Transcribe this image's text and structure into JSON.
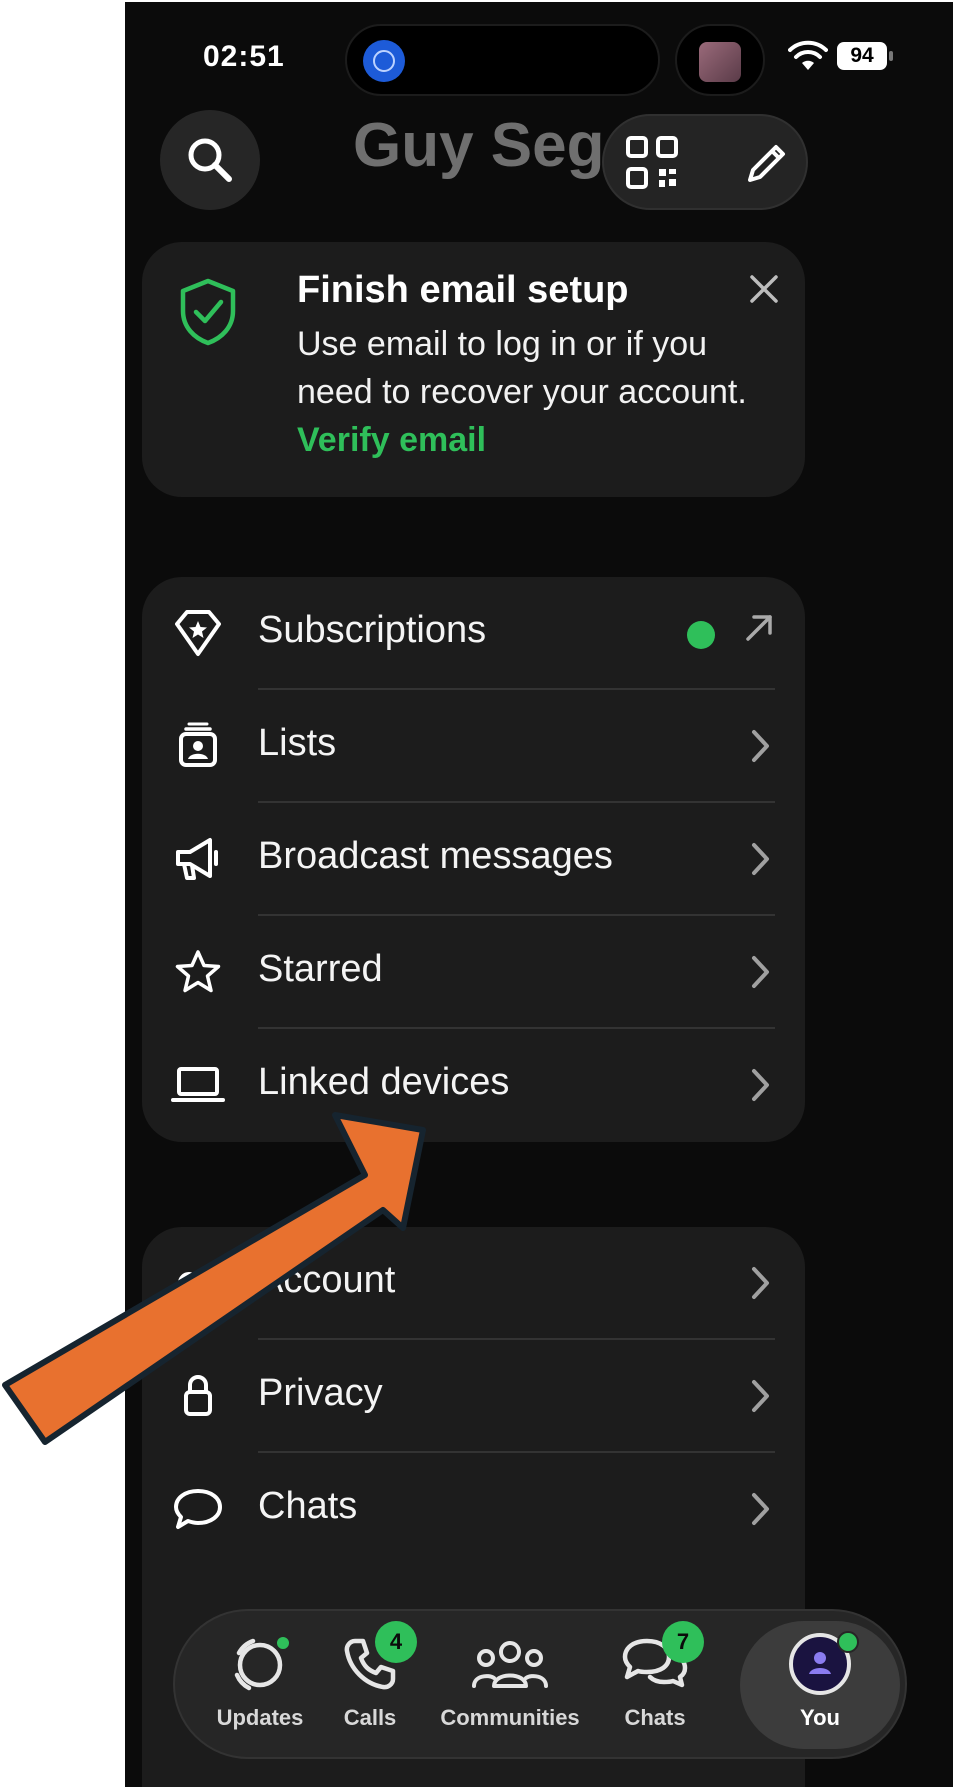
{
  "status_bar": {
    "time": "02:51",
    "battery": "94"
  },
  "header": {
    "title": "Guy Segev"
  },
  "email_card": {
    "title": "Finish email setup",
    "body": "Use email to log in or if you need to recover your account.",
    "link": "Verify email"
  },
  "menu_group_1": [
    {
      "label": "Subscriptions",
      "icon": "diamond-star-icon"
    },
    {
      "label": "Lists",
      "icon": "lists-icon"
    },
    {
      "label": "Broadcast messages",
      "icon": "megaphone-icon"
    },
    {
      "label": "Starred",
      "icon": "star-icon"
    },
    {
      "label": "Linked devices",
      "icon": "laptop-icon"
    }
  ],
  "menu_group_2": [
    {
      "label": "Account",
      "icon": "key-icon"
    },
    {
      "label": "Privacy",
      "icon": "lock-icon"
    },
    {
      "label": "Chats",
      "icon": "chat-bubble-icon"
    }
  ],
  "bottom_nav": {
    "tabs": [
      {
        "label": "Updates",
        "icon": "updates-icon"
      },
      {
        "label": "Calls",
        "icon": "phone-icon",
        "badge": "4"
      },
      {
        "label": "Communities",
        "icon": "communities-icon"
      },
      {
        "label": "Chats",
        "icon": "chats-icon",
        "badge": "7"
      },
      {
        "label": "You",
        "icon": "avatar-icon"
      }
    ]
  },
  "colors": {
    "accent": "#2fbf5a",
    "annotation_arrow": "#e8712f",
    "background": "#0b0b0b",
    "card": "#1c1c1c"
  }
}
